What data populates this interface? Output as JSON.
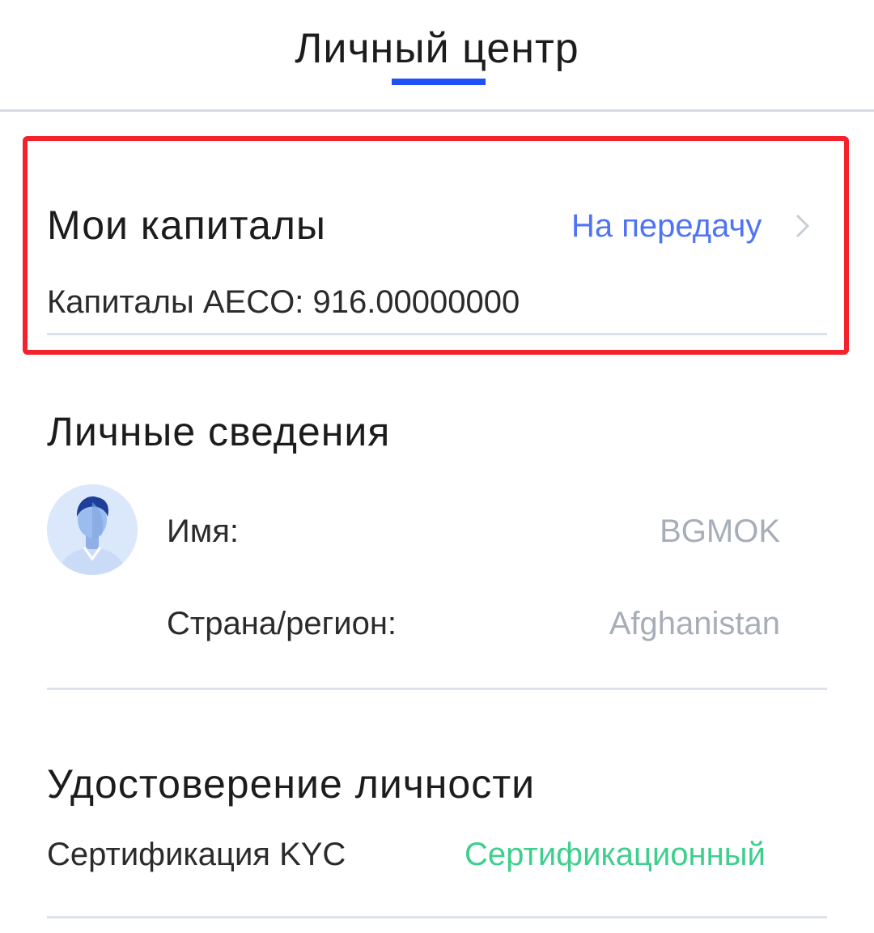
{
  "header": {
    "title": "Личный центр"
  },
  "assets": {
    "title": "Мои капиталы",
    "transfer_label": "На передачу",
    "balance_text": "Капиталы AECO: 916.00000000"
  },
  "personal": {
    "title": "Личные сведения",
    "name_label": "Имя:",
    "name_value": "BGMOK",
    "country_label": "Страна/регион:",
    "country_value": "Afghanistan"
  },
  "identity": {
    "title": "Удостоверение личности",
    "kyc_label": "Сертификация KYC",
    "kyc_status": "Сертификационный"
  },
  "icons": {
    "transfer_chevron": "chevron-right-icon",
    "avatar": "user-avatar-icon"
  },
  "colors": {
    "accent": "#1f52f5",
    "link": "#4f73f5",
    "highlight_border": "#f5222d",
    "success": "#3ecf8e",
    "muted": "#a7aeb8"
  }
}
